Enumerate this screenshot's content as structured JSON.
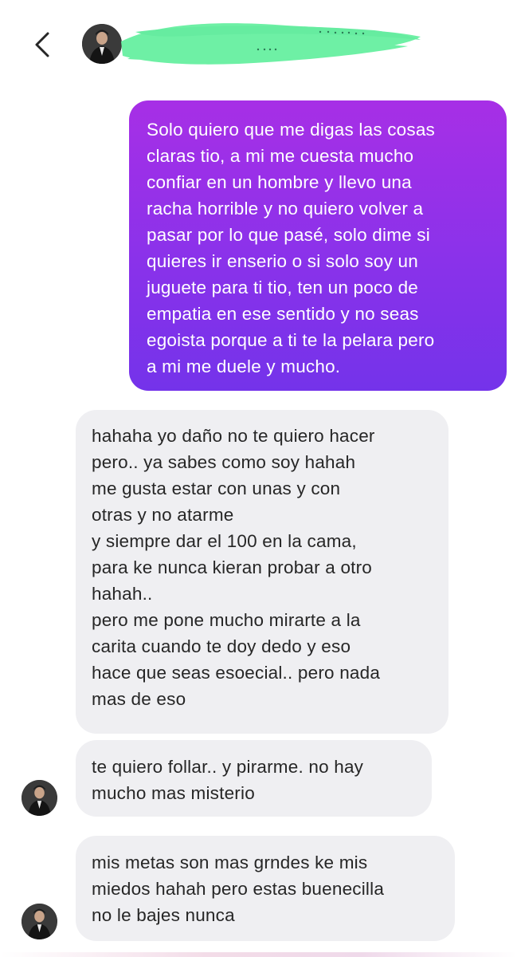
{
  "header": {
    "back_icon": "chevron-left-icon",
    "avatar_icon": "profile-photo-avatar",
    "redaction_color": "#6ef0a5"
  },
  "colors": {
    "outgoing_bubble_top": "#a72fe6",
    "outgoing_bubble_bottom": "#7433ea",
    "incoming_bubble": "#efeff2",
    "incoming_text": "#262626",
    "outgoing_text": "#ffffff"
  },
  "messages": [
    {
      "direction": "outgoing",
      "text": "Solo quiero que me digas las cosas\nclaras tio, a mi me cuesta mucho\nconfiar en un hombre y llevo una\nracha horrible y no quiero volver a\npasar por lo que pasé, solo dime si\nquieres ir enserio o si solo soy un\njuguete para ti tio, ten un poco de\nempatia en ese sentido y no seas\negoista porque a ti te la pelara pero\na mi me duele y mucho."
    },
    {
      "direction": "incoming",
      "text": "hahaha yo daño no te quiero hacer\npero.. ya sabes como soy hahah\nme gusta estar con unas y con\notras y no atarme\ny siempre dar el 100 en la cama,\npara ke nunca kieran probar a otro\nhahah..\npero me pone mucho mirarte a la\ncarita cuando te doy dedo y eso\nhace que seas esoecial.. pero nada\nmas de eso"
    },
    {
      "direction": "incoming",
      "text": "te quiero follar.. y pirarme. no hay\nmucho mas misterio"
    },
    {
      "direction": "incoming",
      "text": "mis metas son mas grndes ke mis\nmiedos hahah pero estas buenecilla\nno le bajes nunca"
    }
  ]
}
